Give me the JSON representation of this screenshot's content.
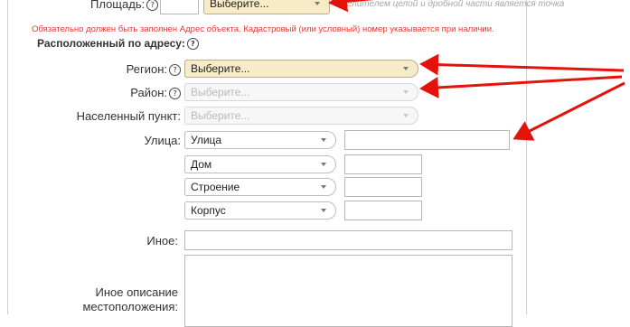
{
  "area": {
    "label": "Площадь:",
    "unit_placeholder": "Выберите...",
    "hint": "...делителем целой и дробной части является точка"
  },
  "notice": "Обязательно должен быть заполнен Адрес объекта. Кадастровый (или условный) номер указывается при наличии.",
  "section_title": "Расположенный по адресу:",
  "region": {
    "label": "Регион:",
    "value": "Выберите..."
  },
  "district": {
    "label": "Район:",
    "value": "Выберите..."
  },
  "locality": {
    "label": "Населенный пункт:",
    "value": "Выберите..."
  },
  "street": {
    "label": "Улица:",
    "type_value": "Улица",
    "value": ""
  },
  "house": {
    "type_value": "Дом",
    "value": ""
  },
  "building": {
    "type_value": "Строение",
    "value": ""
  },
  "corpus": {
    "type_value": "Корпус",
    "value": ""
  },
  "other": {
    "label": "Иное:",
    "value": ""
  },
  "location_desc": {
    "label_line1": "Иное описание",
    "label_line2": "местоположения:",
    "value": ""
  },
  "help_glyph": "?",
  "colors": {
    "annotation_arrow": "#e3120b",
    "highlight_field": "#f8ecc8",
    "notice": "#e03a2a"
  }
}
